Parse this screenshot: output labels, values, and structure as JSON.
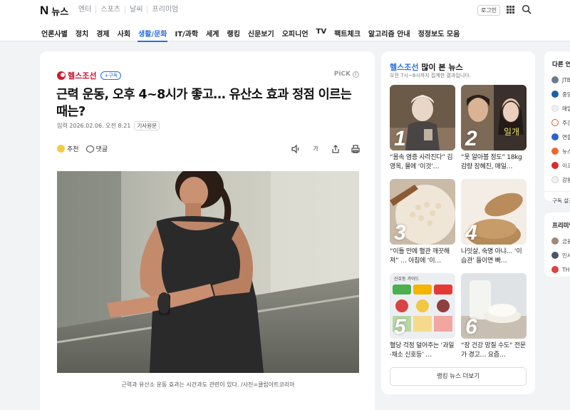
{
  "header": {
    "logo_n": "N",
    "logo_text": "뉴스",
    "service_links": [
      "엔터",
      "스포츠",
      "날씨",
      "프리미엄"
    ],
    "login_label": "로그인",
    "apps_icon": "grid-icon",
    "search_icon": "search-icon"
  },
  "nav": {
    "items": [
      "언론사별",
      "정치",
      "경제",
      "사회",
      "생활/문화",
      "IT/과학",
      "세계",
      "랭킹",
      "신문보기",
      "오피니언",
      "TV",
      "팩트체크",
      "알고리즘 안내",
      "정정보도 모음"
    ],
    "active": "생활/문화",
    "active_color": "#2a6fdb"
  },
  "article": {
    "press_name": "헬스조선",
    "subscribe_label": "+구독",
    "pick_label": "PiCK",
    "headline": "근력 운동, 오후 4~8시가 좋고… 유산소 효과 정점 이르는 때는?",
    "date_label": "입력 2026.02.06. 오전 8:21",
    "original_label": "기사원문",
    "recommend_label": "추천",
    "comment_label": "댓글",
    "tools": [
      "speaker-icon",
      "font-size-icon",
      "share-icon",
      "print-icon"
    ],
    "font_size_glyph": "가",
    "caption": "근력과 유산소 운동 효과는 시간과도 관련이 있다. /사진=클립아트코리아"
  },
  "ranking": {
    "press": "헬스조선",
    "title_suffix": " 많이 본 뉴스",
    "subtitle": "오전 7시~8시까지 집계한 결과입니다.",
    "items": [
      {
        "rank": "1",
        "text": "“몸속 염증 사라진다” 김영옥, 물에 ‘이것’…"
      },
      {
        "rank": "2",
        "text": "“못 알아볼 정도” 18kg 감량 장혜진, 매일…"
      },
      {
        "rank": "3",
        "text": "“이틀 만에 혈관 깨끗해져” … 아침에 ‘이…"
      },
      {
        "rank": "4",
        "text": "나잇살, 숙명 아냐… ‘이 습관’ 들이면 빠…"
      },
      {
        "rank": "5",
        "text": "혈당 걱정 덜어주는 ‘과일·채소 신호등’ …"
      },
      {
        "rank": "6",
        "text": "“장 건강 망칠 수도” 전문가 경고… 요즘…"
      }
    ],
    "thumb5_label": "신호등 가이드",
    "more_label": "랭킹 뉴스 더보기"
  },
  "side_panel": {
    "title": "다른 언론사",
    "rows": [
      "JTBC",
      "중앙",
      "매일",
      "주간",
      "연합",
      "뉴스",
      "이코",
      "강원"
    ],
    "sub_label": "구독 설정",
    "premium_title": "프리미엄",
    "premium_rows": [
      "금융",
      "인사",
      "THE"
    ]
  }
}
